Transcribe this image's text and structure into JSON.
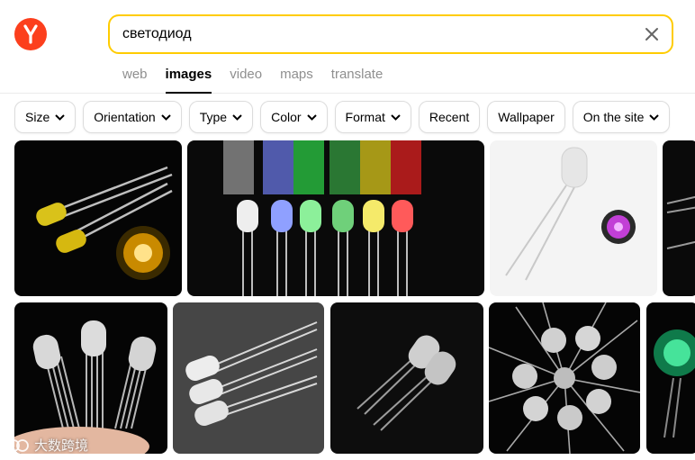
{
  "search": {
    "query": "светодиод"
  },
  "tabs": [
    {
      "label": "web",
      "active": false
    },
    {
      "label": "images",
      "active": true
    },
    {
      "label": "video",
      "active": false
    },
    {
      "label": "maps",
      "active": false
    },
    {
      "label": "translate",
      "active": false
    }
  ],
  "filters": [
    {
      "label": "Size",
      "dropdown": true
    },
    {
      "label": "Orientation",
      "dropdown": true
    },
    {
      "label": "Type",
      "dropdown": true
    },
    {
      "label": "Color",
      "dropdown": true
    },
    {
      "label": "Format",
      "dropdown": true
    },
    {
      "label": "Recent",
      "dropdown": false
    },
    {
      "label": "Wallpaper",
      "dropdown": false
    },
    {
      "label": "On the site",
      "dropdown": true
    }
  ],
  "icons": {
    "logo": "yandex-logo",
    "clear": "close-icon",
    "chevron": "chevron-down-icon"
  },
  "colors": {
    "brand": "#fc3f1d",
    "search_border": "#ffcc00"
  },
  "images": [
    "yellow-led-pair",
    "rgb-led-row",
    "clear-led-pink-glow",
    "dark-led-partial",
    "rgb-4pin-leds-in-hand",
    "three-clear-leds",
    "two-clear-leds",
    "led-circle-arrangement",
    "green-led-partial"
  ],
  "watermark": {
    "text": "大数跨境"
  }
}
